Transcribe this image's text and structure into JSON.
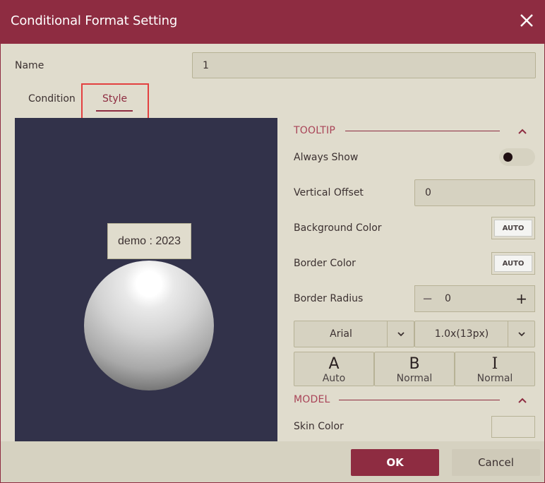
{
  "dialog": {
    "title": "Conditional Format Setting",
    "close_icon": "close-icon"
  },
  "name_field": {
    "label": "Name",
    "value": "1"
  },
  "tabs": [
    {
      "label": "Condition",
      "active": false
    },
    {
      "label": "Style",
      "active": true
    }
  ],
  "preview": {
    "tooltip_text": "demo : 2023",
    "background_color": "#32324a"
  },
  "tooltip_section": {
    "title": "TOOLTIP",
    "always_show": {
      "label": "Always Show",
      "enabled": false
    },
    "vertical_offset": {
      "label": "Vertical Offset",
      "value": "0"
    },
    "background_color": {
      "label": "Background Color",
      "value": "AUTO"
    },
    "border_color": {
      "label": "Border Color",
      "value": "AUTO"
    },
    "border_radius": {
      "label": "Border Radius",
      "value": "0",
      "minus": "−",
      "plus": "+"
    },
    "font_family": {
      "value": "Arial"
    },
    "font_size": {
      "value": "1.0x(13px)"
    },
    "font_color": {
      "glyph": "A",
      "value": "Auto"
    },
    "font_weight": {
      "glyph": "B",
      "value": "Normal"
    },
    "font_style": {
      "glyph": "I",
      "value": "Normal"
    }
  },
  "model_section": {
    "title": "MODEL",
    "skin_color": {
      "label": "Skin Color"
    }
  },
  "footer": {
    "ok_label": "OK",
    "cancel_label": "Cancel"
  },
  "colors": {
    "accent": "#8e2c41",
    "background": "#e0dccd",
    "field_bg": "#d6d2c1"
  }
}
